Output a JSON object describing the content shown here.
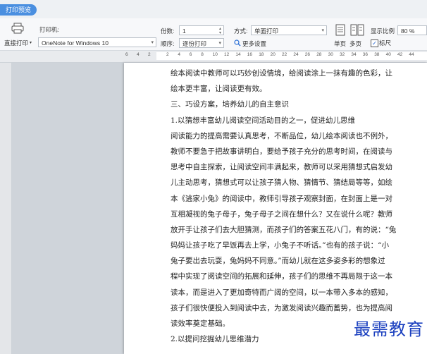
{
  "tab": {
    "label": "打印预览"
  },
  "toolbar": {
    "direct_print_label": "直接打印",
    "printer_label": "打印机:",
    "printer_value": "OneNote for Windows 10",
    "copies_label": "份数:",
    "copies_value": "1",
    "order_label": "顺序:",
    "order_value": "逐份打印",
    "mode_label": "方式:",
    "mode_value": "单面打印",
    "more_settings_label": "更多设置",
    "single_page_label": "单页",
    "multi_page_label": "多页",
    "zoom_label": "显示比例",
    "zoom_value": "80 %",
    "ruler_label": "标尺",
    "ruler_checked": true
  },
  "ruler": {
    "numbers": [
      "6",
      "4",
      "2",
      "2",
      "4",
      "6",
      "8",
      "10",
      "12",
      "14",
      "16",
      "18",
      "20",
      "22",
      "24",
      "26",
      "28",
      "30",
      "32",
      "34",
      "36",
      "38",
      "40",
      "42",
      "44"
    ]
  },
  "document": {
    "lines": [
      "绘本阅读中教师可以巧妙创设情境，给阅读涂上一抹有趣的色彩，让",
      "绘本更丰富，让阅读更有效。",
      "三、巧设方案，培养幼儿的自主意识",
      "1.以猜想丰富幼儿阅读空间活动目的之一，促进幼儿思维",
      "阅读能力的提高需要认真思考，不断品位，幼儿绘本阅读也不例外，",
      "教师不要急于把故事讲明白，要给予孩子充分的思考时间，在阅读与",
      "思考中自主探索，让阅读空间丰满起来，教师可以采用猜想式启发幼",
      "儿主动思考，猜想式可以让孩子猜人物、猜情节、猜结局等等，如绘",
      "本《逃家小兔》的阅读中，教师引导孩子观察封面，在封面上是一对",
      "互相凝视的兔子母子，兔子母子之间在想什么？又在说什么呢？教师",
      "放开手让孩子们去大胆猜测，而孩子们的答案五花八门，有的说：“兔",
      "妈妈让孩子吃了早饭再去上学，小兔子不听话。”也有的孩子说：“小",
      "兔子要出去玩耍，兔妈妈不同意。”而幼儿就在这多姿多彩的想象过",
      "程中实现了阅读空间的拓展和延伸，孩子们的思维不再局限于这一本",
      "读本，而是进入了更加奇特而广阔的空间，以一本带入多本的感知，",
      "孩子们很快便投入到阅读中去，为激发阅读兴趣而蓄势，也为提高阅",
      "读效率奠定基础。",
      "2.以提问挖掘幼儿思维潜力"
    ]
  },
  "watermark": {
    "text": "最需教育"
  }
}
